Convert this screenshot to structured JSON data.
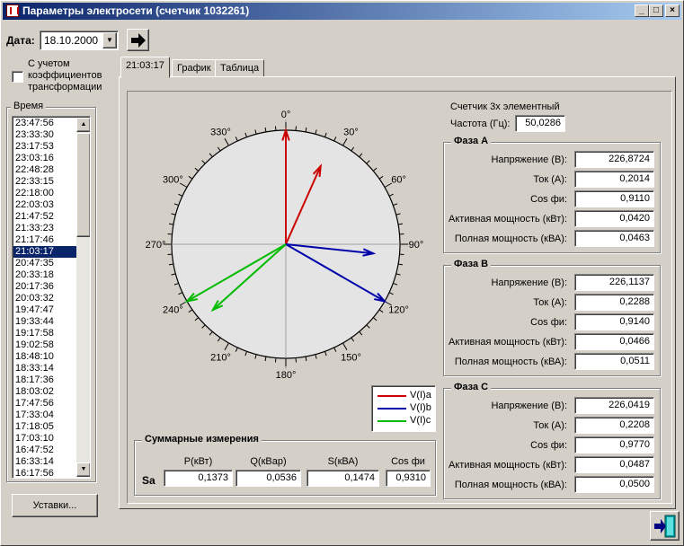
{
  "window": {
    "title": "Параметры электросети (счетчик 1032261)"
  },
  "date": {
    "label": "Дата:",
    "value": "18.10.2000"
  },
  "checkbox": {
    "label_line1": "С учетом",
    "label_line2": "коэффициентов",
    "label_line3": "трансформации",
    "checked": false
  },
  "time_list": {
    "label": "Время",
    "selected_index": 11,
    "items": [
      "23:47:56",
      "23:33:30",
      "23:17:53",
      "23:03:16",
      "22:48:28",
      "22:33:15",
      "22:18:00",
      "22:03:03",
      "21:47:52",
      "21:33:23",
      "21:17:46",
      "21:03:17",
      "20:47:35",
      "20:33:18",
      "20:17:36",
      "20:03:32",
      "19:47:47",
      "19:33:44",
      "19:17:58",
      "19:02:58",
      "18:48:10",
      "18:33:14",
      "18:17:36",
      "18:03:02",
      "17:47:56",
      "17:33:04",
      "17:18:05",
      "17:03:10",
      "16:47:52",
      "16:33:14",
      "16:17:56"
    ]
  },
  "settings_button": {
    "label": "Уставки..."
  },
  "tabs": [
    {
      "label": "21:03:17"
    },
    {
      "label": "График"
    },
    {
      "label": "Таблица"
    }
  ],
  "meter": {
    "type_text": "Счетчик 3х элементный",
    "freq_label": "Частота (Гц):",
    "freq_value": "50,0286"
  },
  "phases": [
    {
      "title": "Фаза A",
      "rows": [
        {
          "label": "Напряжение (В):",
          "value": "226,8724"
        },
        {
          "label": "Ток (А):",
          "value": "0,2014"
        },
        {
          "label": "Cos фи:",
          "value": "0,9110"
        },
        {
          "label": "Активная мощность (кВт):",
          "value": "0,0420"
        },
        {
          "label": "Полная мощность (кВА):",
          "value": "0,0463"
        }
      ]
    },
    {
      "title": "Фаза B",
      "rows": [
        {
          "label": "Напряжение (В):",
          "value": "226,1137"
        },
        {
          "label": "Ток (А):",
          "value": "0,2288"
        },
        {
          "label": "Cos фи:",
          "value": "0,9140"
        },
        {
          "label": "Активная мощность (кВт):",
          "value": "0,0466"
        },
        {
          "label": "Полная мощность (кВА):",
          "value": "0,0511"
        }
      ]
    },
    {
      "title": "Фаза C",
      "rows": [
        {
          "label": "Напряжение (В):",
          "value": "226,0419"
        },
        {
          "label": "Ток (А):",
          "value": "0,2208"
        },
        {
          "label": "Cos фи:",
          "value": "0,9770"
        },
        {
          "label": "Активная мощность (кВт):",
          "value": "0,0487"
        },
        {
          "label": "Полная мощность (кВА):",
          "value": "0,0500"
        }
      ]
    }
  ],
  "summary": {
    "title": "Суммарные измерения",
    "row_label": "Sa",
    "columns": [
      {
        "header": "P(кВт)",
        "value": "0,1373"
      },
      {
        "header": "Q(кВар)",
        "value": "0,0536"
      },
      {
        "header": "S(кВА)",
        "value": "0,1474"
      },
      {
        "header": "Cos фи",
        "value": "0,9310"
      }
    ]
  },
  "chart_data": {
    "type": "polar-vector",
    "angle_labels": [
      "0°",
      "30°",
      "60°",
      "90°",
      "120°",
      "150°",
      "180°",
      "210°",
      "240°",
      "270°",
      "300°",
      "330°"
    ],
    "legend": [
      {
        "name": "V(I)a",
        "color": "#cc0000"
      },
      {
        "name": "V(I)b",
        "color": "#0000aa"
      },
      {
        "name": "V(I)c",
        "color": "#00bb00"
      }
    ],
    "vectors": [
      {
        "series": "V(I)a",
        "kind": "voltage",
        "angle_deg": 0,
        "magnitude": 1.0,
        "color": "#cc0000"
      },
      {
        "series": "V(I)a",
        "kind": "current",
        "angle_deg": 24,
        "magnitude": 0.75,
        "color": "#cc0000"
      },
      {
        "series": "V(I)b",
        "kind": "voltage",
        "angle_deg": 120,
        "magnitude": 1.0,
        "color": "#0000aa"
      },
      {
        "series": "V(I)b",
        "kind": "current",
        "angle_deg": 96,
        "magnitude": 0.77,
        "color": "#0000aa"
      },
      {
        "series": "V(I)c",
        "kind": "voltage",
        "angle_deg": 240,
        "magnitude": 1.0,
        "color": "#00bb00"
      },
      {
        "series": "V(I)c",
        "kind": "current",
        "angle_deg": 228,
        "magnitude": 0.86,
        "color": "#00bb00"
      }
    ]
  }
}
